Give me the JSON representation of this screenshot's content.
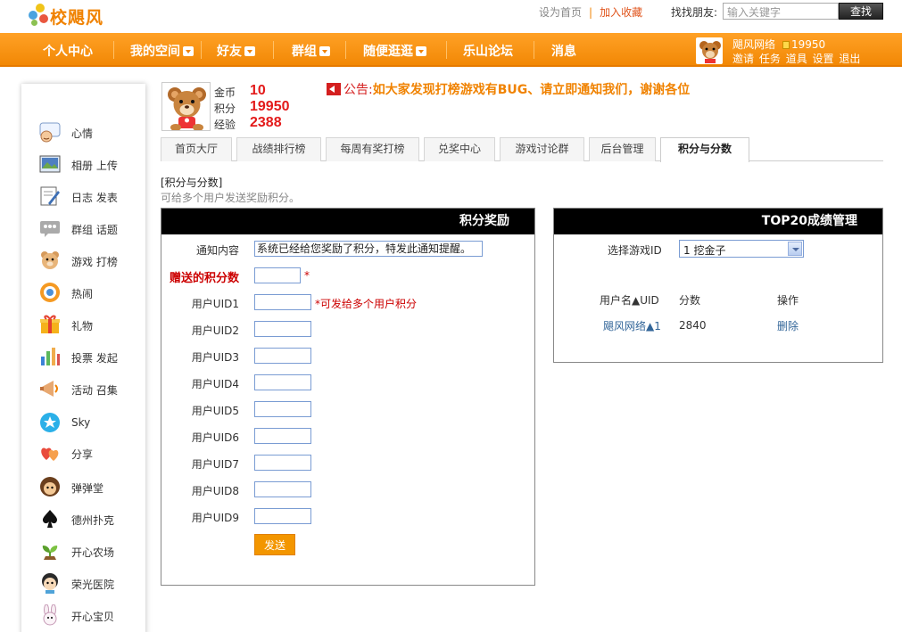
{
  "header": {
    "logo_text": "校飓风",
    "links": [
      "设为首页",
      "加入收藏"
    ],
    "find_friend_label": "找找朋友:",
    "search_placeholder": "输入关键字",
    "search_button": "查找"
  },
  "nav": {
    "items": [
      {
        "label": "个人中心",
        "dropdown": false
      },
      {
        "label": "我的空间",
        "dropdown": true
      },
      {
        "label": "好友",
        "dropdown": true
      },
      {
        "label": "群组",
        "dropdown": true
      },
      {
        "label": "随便逛逛",
        "dropdown": true
      },
      {
        "label": "乐山论坛",
        "dropdown": false
      },
      {
        "label": "消息",
        "dropdown": false
      }
    ],
    "user": {
      "name": "飓风网络",
      "coins": "19950",
      "links": [
        "邀请",
        "任务",
        "道具",
        "设置",
        "退出"
      ]
    }
  },
  "sidebar": {
    "items": [
      {
        "label": "心情",
        "icon": "mood-icon"
      },
      {
        "label": "相册 上传",
        "icon": "album-icon"
      },
      {
        "label": "日志 发表",
        "icon": "blog-icon"
      },
      {
        "label": "群组 话题",
        "icon": "group-icon"
      },
      {
        "label": "游戏 打榜",
        "icon": "game-icon"
      },
      {
        "label": "热闹",
        "icon": "hot-icon"
      },
      {
        "label": "礼物",
        "icon": "gift-icon"
      },
      {
        "label": "投票 发起",
        "icon": "poll-icon"
      },
      {
        "label": "活动 召集",
        "icon": "event-icon"
      },
      {
        "label": "Sky",
        "icon": "star-icon"
      },
      {
        "label": "分享",
        "icon": "share-icon"
      },
      {
        "label": "弹弹堂",
        "icon": "ddt-icon"
      },
      {
        "label": "德州扑克",
        "icon": "spade-icon"
      },
      {
        "label": "开心农场",
        "icon": "farm-icon"
      },
      {
        "label": "荣光医院",
        "icon": "hospital-icon"
      },
      {
        "label": "开心宝贝",
        "icon": "bunny-icon"
      }
    ]
  },
  "profile": {
    "stats": [
      {
        "label": "金币",
        "value": "10"
      },
      {
        "label": "积分",
        "value": "19950"
      },
      {
        "label": "经验",
        "value": "2388"
      }
    ]
  },
  "notice": {
    "label": "公告:",
    "text": "如大家发现打榜游戏有BUG、请立即通知我们，谢谢各位"
  },
  "tabs": [
    "首页大厅",
    "战绩排行榜",
    "每周有奖打榜",
    "兑奖中心",
    "游戏讨论群",
    "后台管理",
    "积分与分数"
  ],
  "active_tab": "积分与分数",
  "section": {
    "title": "[积分与分数]",
    "desc": "可给多个用户发送奖励积分。"
  },
  "reward_form": {
    "heading": "积分奖励",
    "notify_label": "通知内容",
    "notify_value": "系统已经给您奖励了积分，特发此通知提醒。",
    "points_label": "赠送的积分数",
    "points_required": "*",
    "uid_hint": "*可发给多个用户积分",
    "uid_labels": [
      "用户UID1",
      "用户UID2",
      "用户UID3",
      "用户UID4",
      "用户UID5",
      "用户UID6",
      "用户UID7",
      "用户UID8",
      "用户UID9"
    ],
    "send_button": "发送"
  },
  "top20": {
    "heading": "TOP20成绩管理",
    "select_label": "选择游戏ID",
    "select_value": "1 挖金子",
    "columns": [
      "用户名▲UID",
      "分数",
      "操作"
    ],
    "rows": [
      {
        "user": "飓风网络▲1",
        "score": "2840",
        "action": "删除"
      }
    ]
  }
}
